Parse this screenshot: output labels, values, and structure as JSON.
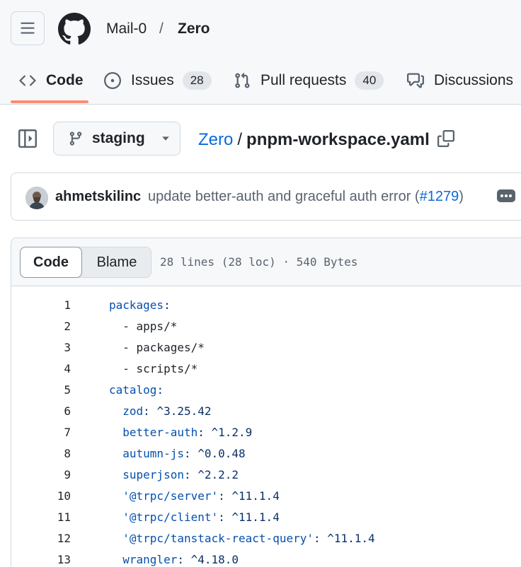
{
  "header": {
    "owner": "Mail-0",
    "separator": "/",
    "repo": "Zero"
  },
  "tabs": [
    {
      "label": "Code",
      "icon": "code-icon",
      "active": true
    },
    {
      "label": "Issues",
      "icon": "issue-icon",
      "count": "28"
    },
    {
      "label": "Pull requests",
      "icon": "pull-request-icon",
      "count": "40"
    },
    {
      "label": "Discussions",
      "icon": "discussions-icon"
    }
  ],
  "filenav": {
    "branch": "staging",
    "path_root": "Zero",
    "path_sep": "/",
    "filename": "pnpm-workspace.yaml"
  },
  "commit": {
    "author": "ahmetskilinc",
    "message_prefix": "update better-auth and graceful auth error (",
    "pr_link": "#1279",
    "message_suffix": ")"
  },
  "codebox": {
    "tab_code": "Code",
    "tab_blame": "Blame",
    "meta": "28 lines (28 loc) · 540 Bytes"
  },
  "lines": [
    {
      "n": "1",
      "indent": "",
      "key": "packages",
      "rest": ":"
    },
    {
      "n": "2",
      "indent": "  ",
      "dash": "- ",
      "value": "apps/*"
    },
    {
      "n": "3",
      "indent": "  ",
      "dash": "- ",
      "value": "packages/*"
    },
    {
      "n": "4",
      "indent": "  ",
      "dash": "- ",
      "value": "scripts/*"
    },
    {
      "n": "5",
      "indent": "",
      "key": "catalog",
      "rest": ":"
    },
    {
      "n": "6",
      "indent": "  ",
      "key": "zod",
      "rest": ": ^3.25.42"
    },
    {
      "n": "7",
      "indent": "  ",
      "key": "better-auth",
      "rest": ": ^1.2.9"
    },
    {
      "n": "8",
      "indent": "  ",
      "key": "autumn-js",
      "rest": ": ^0.0.48"
    },
    {
      "n": "9",
      "indent": "  ",
      "key": "superjson",
      "rest": ": ^2.2.2"
    },
    {
      "n": "10",
      "indent": "  ",
      "qkey": "'@trpc/server'",
      "rest": ": ^11.1.4"
    },
    {
      "n": "11",
      "indent": "  ",
      "qkey": "'@trpc/client'",
      "rest": ": ^11.1.4"
    },
    {
      "n": "12",
      "indent": "  ",
      "qkey": "'@trpc/tanstack-react-query'",
      "rest": ": ^11.1.4"
    },
    {
      "n": "13",
      "indent": "  ",
      "key": "wrangler",
      "rest": ": ^4.18.0"
    }
  ],
  "colors": {
    "link": "#0969da",
    "key": "#0550ae",
    "active_tab_underline": "#fd8c73"
  }
}
